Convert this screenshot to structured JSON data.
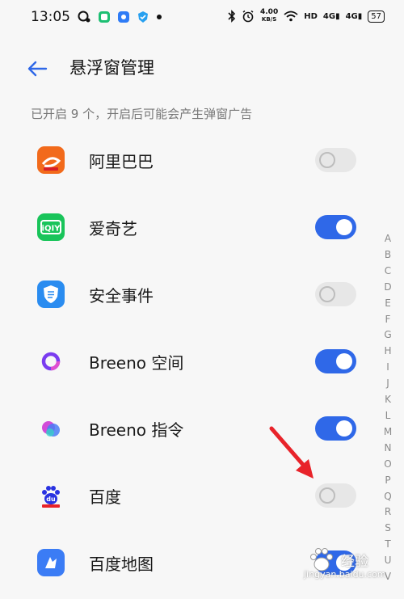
{
  "status_bar": {
    "time": "13:05",
    "speed_value": "4.00",
    "speed_unit": "KB/S",
    "hd_label": "HD",
    "net1": "4G",
    "net2": "4G",
    "battery": "57"
  },
  "header": {
    "title": "悬浮窗管理",
    "back_icon": "arrow-left-icon"
  },
  "subtitle": "已开启 9 个，开启后可能会产生弹窗广告",
  "apps": [
    {
      "name": "阿里巴巴",
      "enabled": false,
      "icon": "alibaba-icon",
      "color": "#f05a22"
    },
    {
      "name": "爱奇艺",
      "enabled": true,
      "icon": "iqiyi-icon",
      "color": "#19c45a"
    },
    {
      "name": "安全事件",
      "enabled": false,
      "icon": "shield-icon",
      "color": "#2a8cf0"
    },
    {
      "name": "Breeno 空间",
      "enabled": true,
      "icon": "breeno-space-icon",
      "color": "#7a3cf0"
    },
    {
      "name": "Breeno 指令",
      "enabled": true,
      "icon": "breeno-command-icon",
      "color": "#d24bd8"
    },
    {
      "name": "百度",
      "enabled": false,
      "icon": "baidu-paw-icon",
      "color": "#2932e1"
    },
    {
      "name": "百度地图",
      "enabled": true,
      "icon": "baidu-map-icon",
      "color": "#3b7cf5"
    }
  ],
  "alphabet": [
    "A",
    "B",
    "C",
    "D",
    "E",
    "F",
    "G",
    "H",
    "I",
    "J",
    "K",
    "L",
    "M",
    "N",
    "O",
    "P",
    "Q",
    "R",
    "S",
    "T",
    "U",
    "V"
  ],
  "colors": {
    "accent": "#2f68e8",
    "toggle_off": "#e7e7e7",
    "annotation": "#e8232a"
  },
  "watermark": {
    "text1": "经验",
    "text2": "jingyan.baidu.com"
  }
}
